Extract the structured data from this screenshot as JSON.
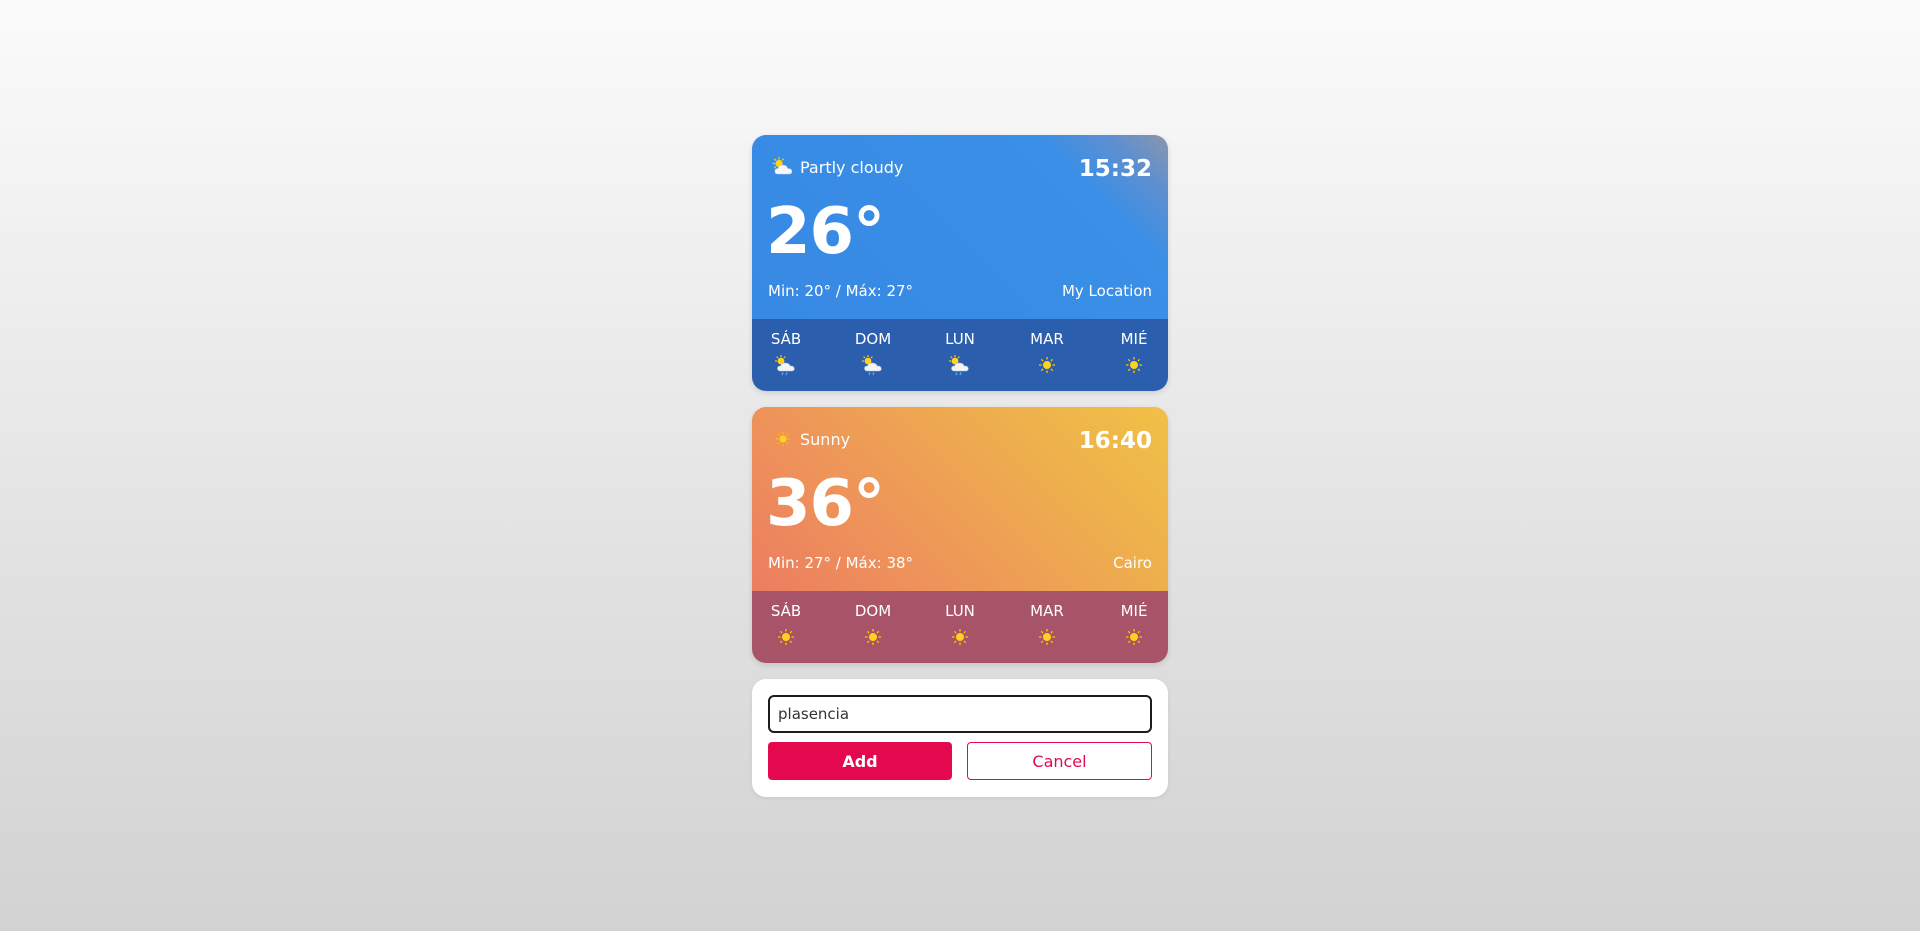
{
  "cards": [
    {
      "theme": "blue",
      "condition": "Partly cloudy",
      "condition_icon": "partly-cloudy-icon",
      "time": "15:32",
      "temperature": "26°",
      "minmax": "Min: 20° / Máx: 27°",
      "location": "My Location",
      "forecast": [
        {
          "day": "SÁB",
          "icon": "partly-cloudy-rain-icon"
        },
        {
          "day": "DOM",
          "icon": "partly-cloudy-rain-icon"
        },
        {
          "day": "LUN",
          "icon": "partly-cloudy-rain-icon"
        },
        {
          "day": "MAR",
          "icon": "sun-icon"
        },
        {
          "day": "MIÉ",
          "icon": "sun-icon"
        }
      ]
    },
    {
      "theme": "orange",
      "condition": "Sunny",
      "condition_icon": "sun-icon",
      "time": "16:40",
      "temperature": "36°",
      "minmax": "Min: 27° / Máx: 38°",
      "location": "Cairo",
      "forecast": [
        {
          "day": "SÁB",
          "icon": "sun-icon"
        },
        {
          "day": "DOM",
          "icon": "sun-icon"
        },
        {
          "day": "LUN",
          "icon": "sun-icon"
        },
        {
          "day": "MAR",
          "icon": "sun-icon"
        },
        {
          "day": "MIÉ",
          "icon": "sun-icon"
        }
      ]
    }
  ],
  "form": {
    "input_value": "plasencia",
    "add_label": "Add",
    "cancel_label": "Cancel"
  },
  "colors": {
    "accent": "#e4094f",
    "blue_card": "#3789e4",
    "blue_forecast": "#2b5fae",
    "orange_card": "#ee9659",
    "orange_forecast": "#a75468",
    "sun": "#ffcc00"
  }
}
